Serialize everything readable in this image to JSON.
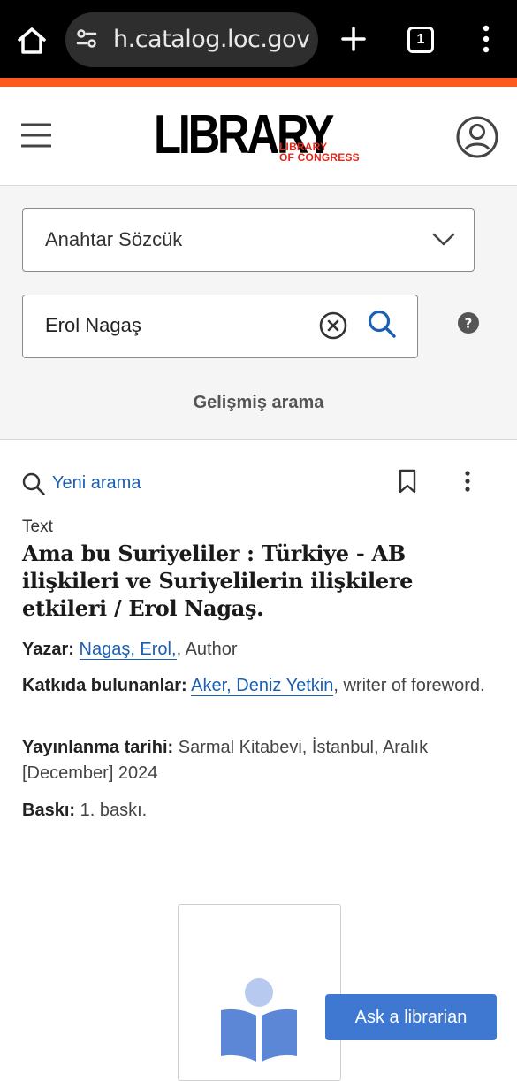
{
  "browser": {
    "url": "h.catalog.loc.gov",
    "tab_count": "1",
    "icons": [
      "home-icon",
      "site-settings-icon",
      "plus-icon",
      "tab-switcher-icon",
      "kebab-menu-icon"
    ]
  },
  "header": {
    "logo_main": "LIBRARY",
    "logo_sub_line1": "LIBRARY",
    "logo_sub_line2": "OF CONGRESS",
    "icons": [
      "hamburger-menu-icon",
      "user-account-icon"
    ]
  },
  "search": {
    "scope_selected": "Anahtar Sözcük",
    "query": "Erol Nagaş",
    "advanced_label": "Gelişmiş arama"
  },
  "results": {
    "new_search_label": "Yeni arama",
    "format": "Text",
    "title": "Ama bu Suriyeliler : Türkiye - AB ilişkileri ve Suriyelilerin ilişkilere etkileri / Erol Nagaş.",
    "author": {
      "label": "Yazar:",
      "link": "Nagaş, Erol,",
      "suffix": ", Author"
    },
    "contributors": {
      "label": "Katkıda bulunanlar:",
      "link": "Aker, Deniz Yetkin",
      "suffix": ", writer of foreword."
    },
    "publication": {
      "label": "Yayınlanma tarihi:",
      "value": "Sarmal Kitabevi, İstanbul, Aralık [December] 2024"
    },
    "edition": {
      "label": "Baskı:",
      "value": "1. baskı."
    }
  },
  "ask_button": "Ask a librarian",
  "colors": {
    "accent_orange": "#ff5a1e",
    "link_blue": "#1a5fb4",
    "logo_red": "#e4261b",
    "button_blue": "#3f78d0"
  }
}
